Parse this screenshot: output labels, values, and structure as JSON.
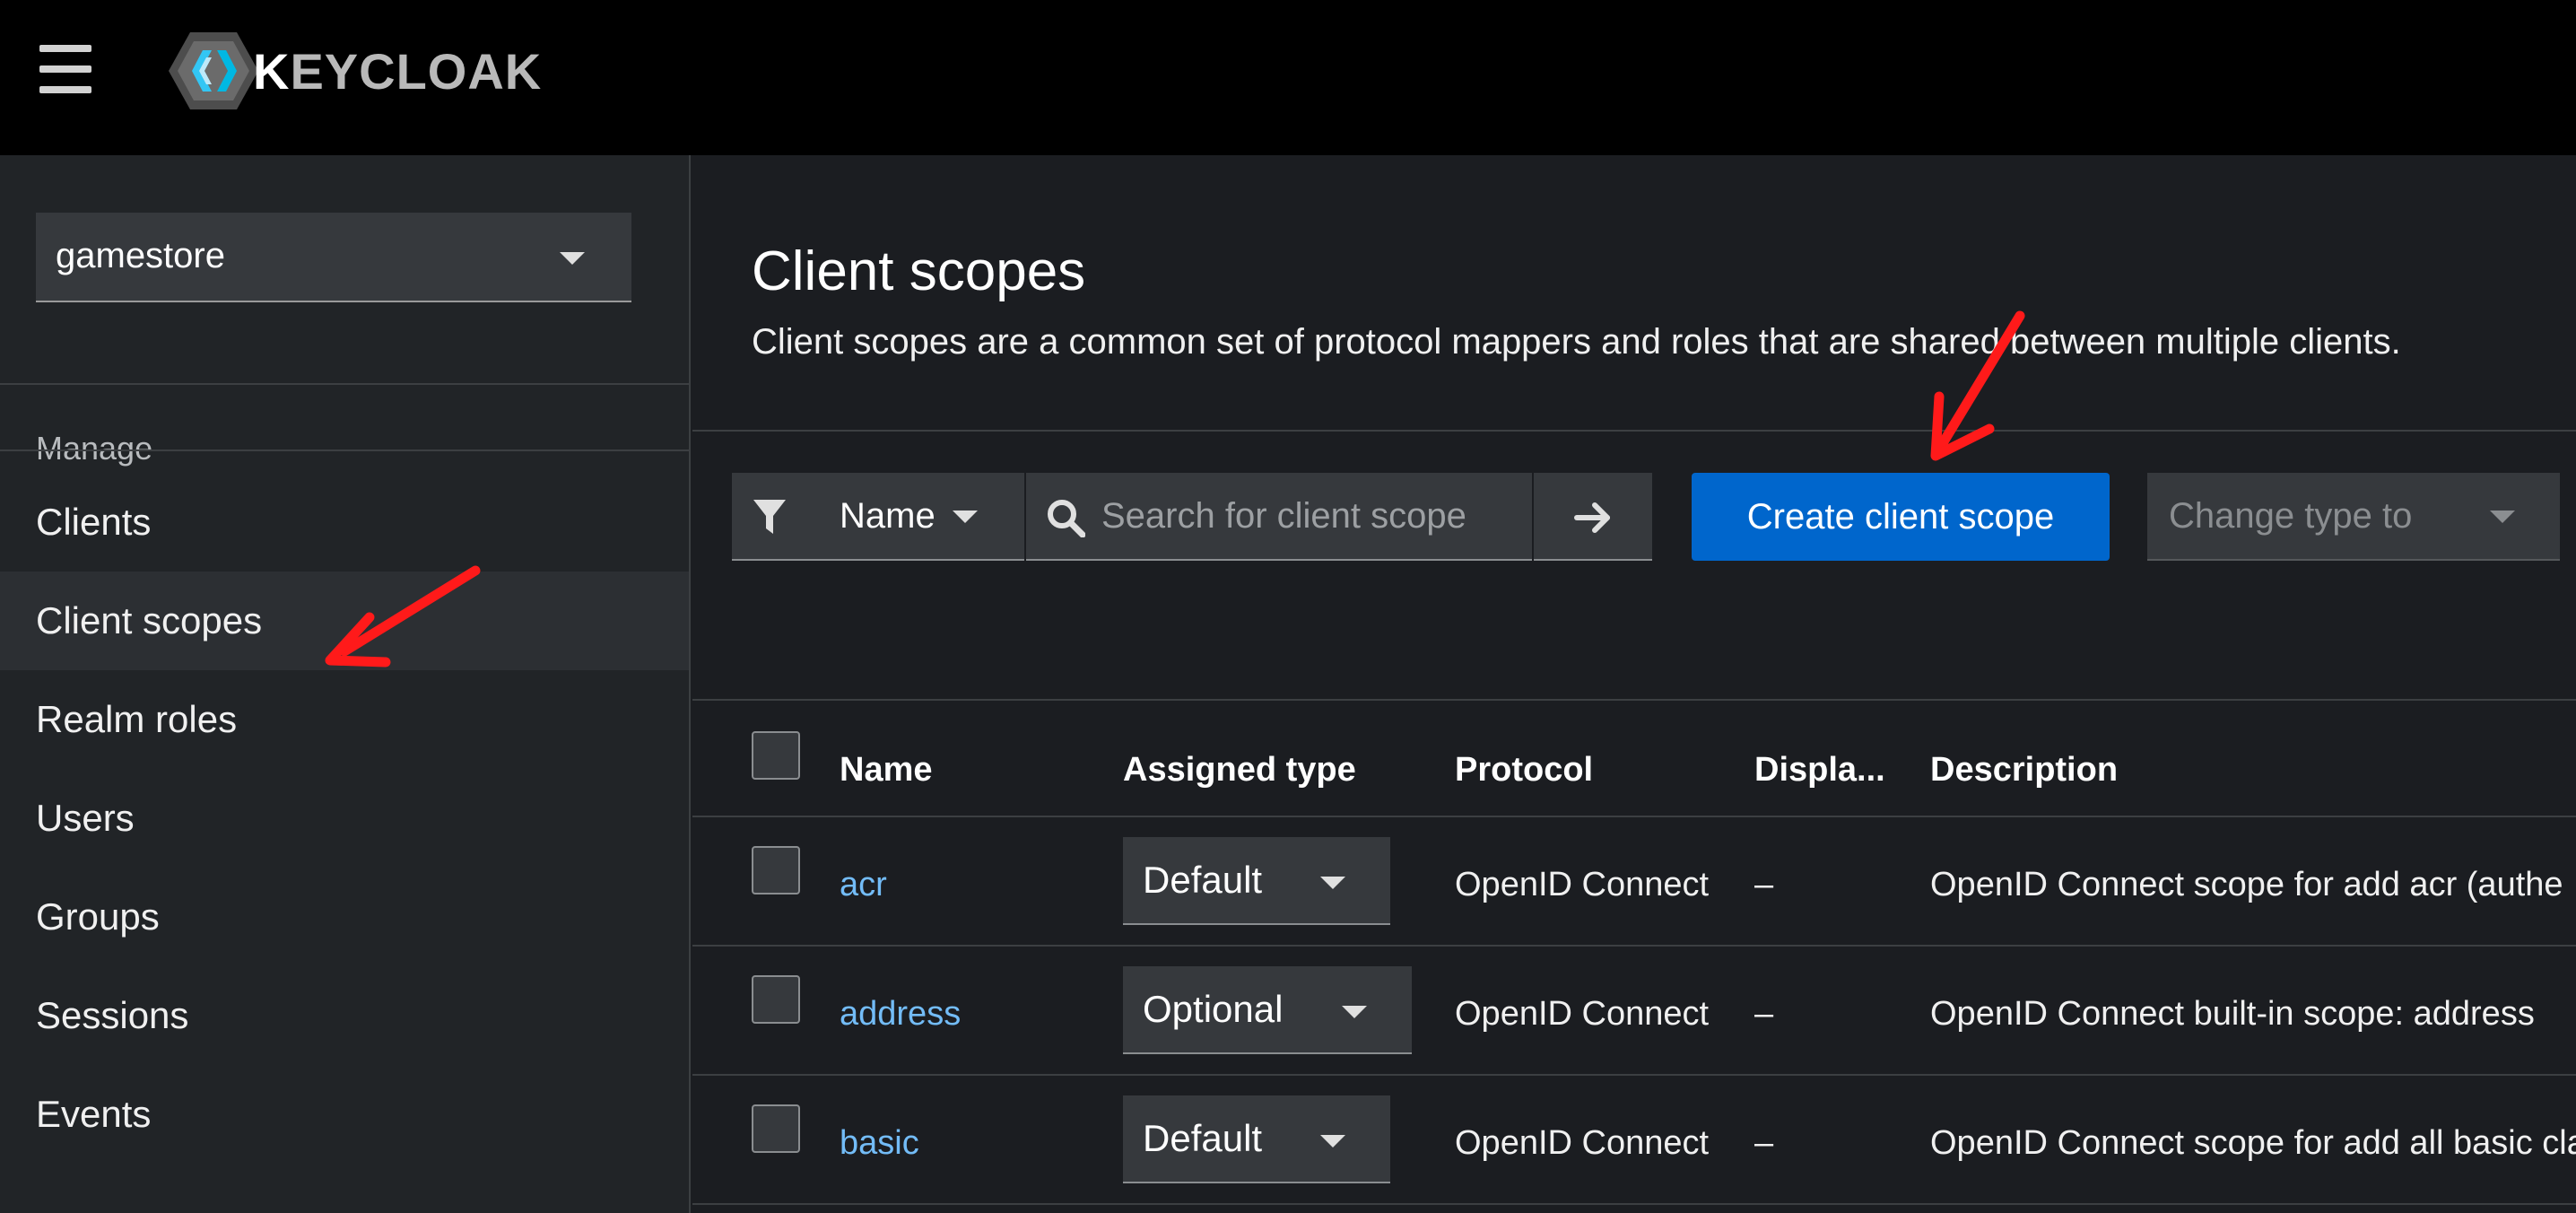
{
  "header": {
    "brand_k": "K",
    "brand_rest": "EYCLOAK"
  },
  "sidebar": {
    "realm": "gamestore",
    "section_label": "Manage",
    "items": [
      {
        "label": "Clients"
      },
      {
        "label": "Client scopes",
        "active": true
      },
      {
        "label": "Realm roles"
      },
      {
        "label": "Users"
      },
      {
        "label": "Groups"
      },
      {
        "label": "Sessions"
      },
      {
        "label": "Events"
      }
    ]
  },
  "main": {
    "title": "Client scopes",
    "description": "Client scopes are a common set of protocol mappers and roles that are shared between multiple clients.",
    "toolbar": {
      "filter_label": "Name",
      "search_placeholder": "Search for client scope",
      "create_label": "Create client scope",
      "change_type_label": "Change type to"
    },
    "table": {
      "columns": [
        "Name",
        "Assigned type",
        "Protocol",
        "Displa...",
        "Description"
      ],
      "rows": [
        {
          "name": "acr",
          "assigned_type": "Default",
          "protocol": "OpenID Connect",
          "display": "–",
          "description": "OpenID Connect scope for add acr (authe"
        },
        {
          "name": "address",
          "assigned_type": "Optional",
          "protocol": "OpenID Connect",
          "display": "–",
          "description": "OpenID Connect built-in scope: address"
        },
        {
          "name": "basic",
          "assigned_type": "Default",
          "protocol": "OpenID Connect",
          "display": "–",
          "description": "OpenID Connect scope for add all basic cla"
        }
      ]
    }
  },
  "colors": {
    "primary_button": "#0066cc",
    "link": "#73bcf7",
    "annotation_arrow": "#ff1a1a"
  }
}
